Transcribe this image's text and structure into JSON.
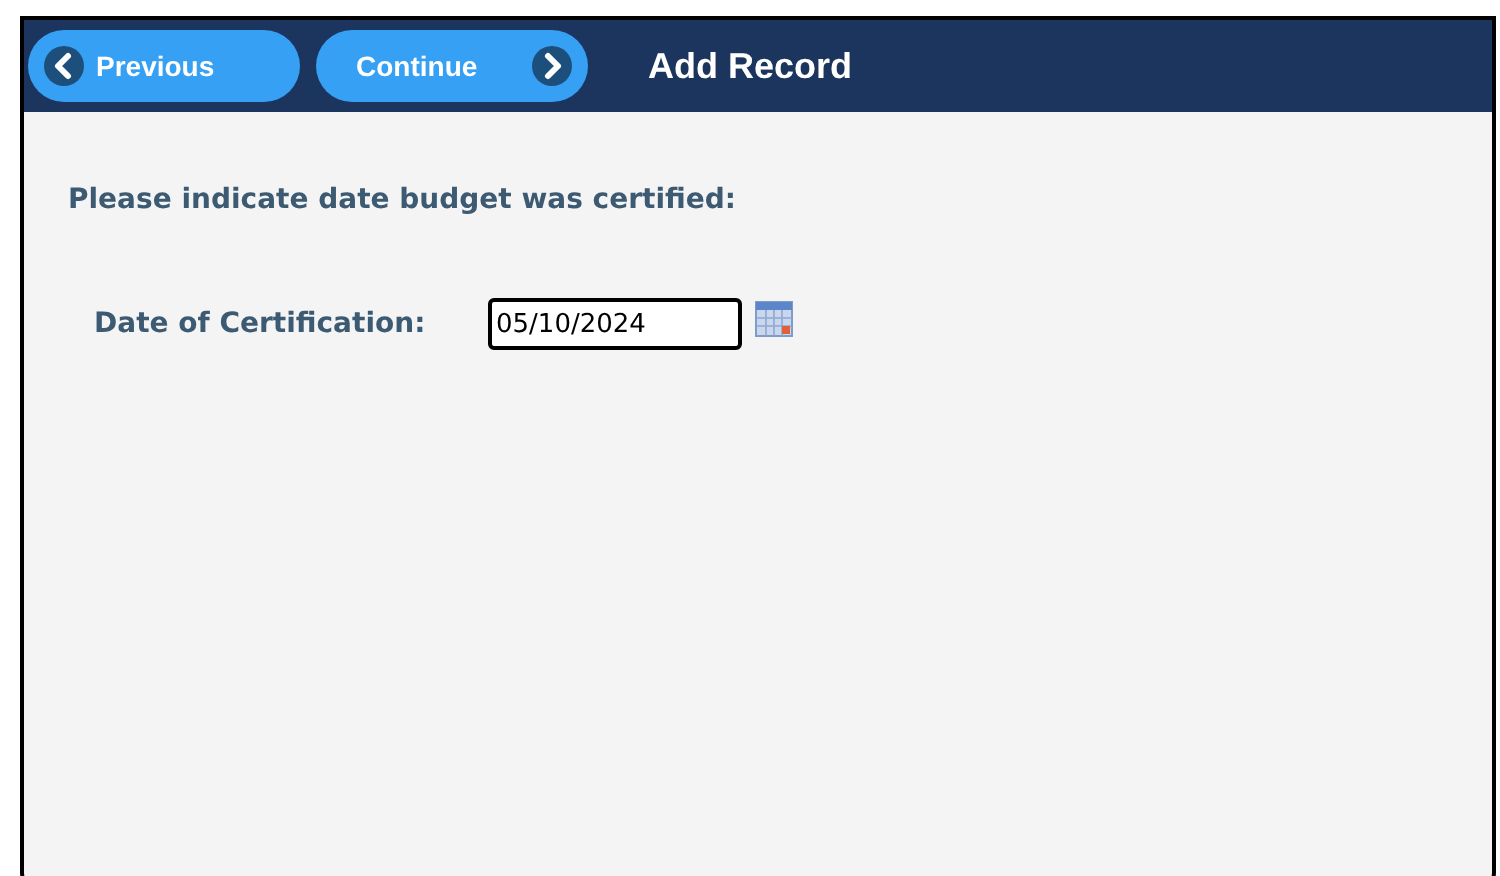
{
  "header": {
    "buttons": [
      {
        "label": "Previous",
        "kind": "back"
      },
      {
        "label": "Continue",
        "kind": "forward"
      }
    ],
    "title": "Add Record"
  },
  "prompt": "Please indicate date budget was certified:",
  "field": {
    "label": "Date of Certification:",
    "value": "05/10/2024"
  }
}
